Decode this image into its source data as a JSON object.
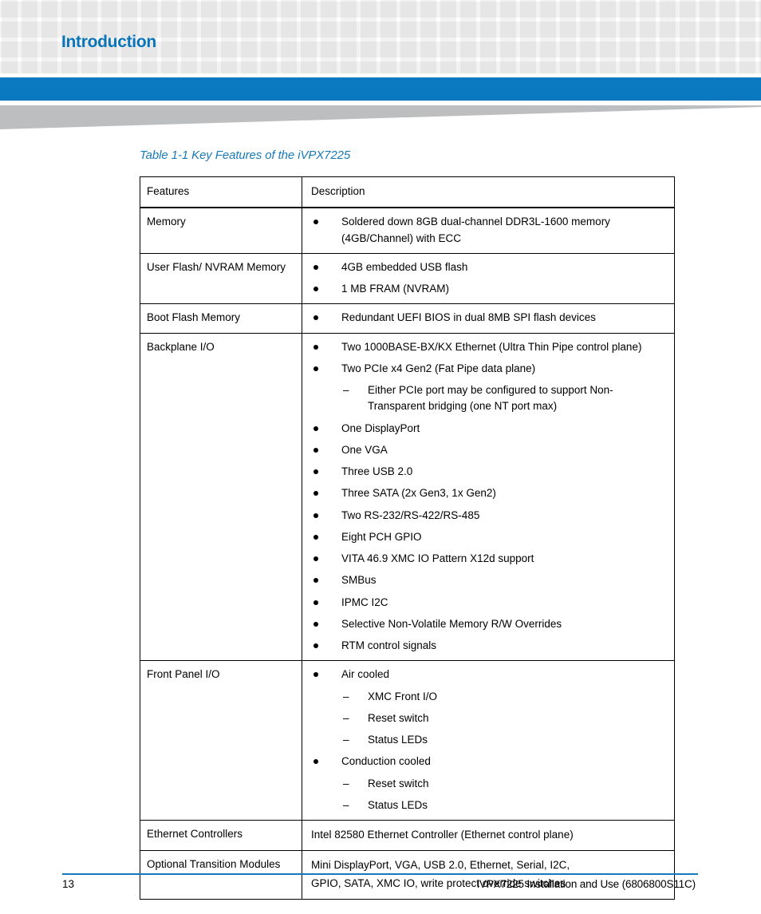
{
  "header": {
    "chapter_title": "Introduction"
  },
  "caption": {
    "text": "Table 1-1 Key Features of the iVPX7225"
  },
  "table": {
    "columns": [
      "Features",
      "Description"
    ],
    "rows": [
      {
        "feature": "Memory",
        "items": [
          {
            "level": 1,
            "text": "Soldered down 8GB dual-channel DDR3L-1600 memory (4GB/Channel) with ECC"
          }
        ]
      },
      {
        "feature": "User Flash/ NVRAM Memory",
        "items": [
          {
            "level": 1,
            "text": "4GB embedded USB flash"
          },
          {
            "level": 1,
            "text": "1 MB FRAM (NVRAM)"
          }
        ]
      },
      {
        "feature": "Boot Flash Memory",
        "items": [
          {
            "level": 1,
            "text": "Redundant UEFI BIOS in dual 8MB SPI flash devices"
          }
        ]
      },
      {
        "feature": "Backplane I/O",
        "items": [
          {
            "level": 1,
            "text": "Two 1000BASE-BX/KX Ethernet (Ultra Thin Pipe control plane)"
          },
          {
            "level": 1,
            "text": "Two PCIe x4 Gen2 (Fat Pipe data plane)"
          },
          {
            "level": 2,
            "text": "Either PCIe port may be configured to support Non-Transparent bridging (one NT port max)"
          },
          {
            "level": 1,
            "text": "One DisplayPort"
          },
          {
            "level": 1,
            "text": "One VGA"
          },
          {
            "level": 1,
            "text": "Three USB 2.0"
          },
          {
            "level": 1,
            "text": "Three SATA (2x Gen3, 1x Gen2)"
          },
          {
            "level": 1,
            "text": "Two RS-232/RS-422/RS-485"
          },
          {
            "level": 1,
            "text": "Eight PCH GPIO"
          },
          {
            "level": 1,
            "text": "VITA 46.9 XMC IO Pattern X12d support"
          },
          {
            "level": 1,
            "text": "SMBus"
          },
          {
            "level": 1,
            "text": "IPMC I2C"
          },
          {
            "level": 1,
            "text": "Selective Non-Volatile Memory R/W Overrides"
          },
          {
            "level": 1,
            "text": "RTM control signals"
          }
        ]
      },
      {
        "feature": "Front Panel I/O",
        "items": [
          {
            "level": 1,
            "text": "Air cooled"
          },
          {
            "level": 2,
            "text": "XMC Front I/O"
          },
          {
            "level": 2,
            "text": "Reset switch"
          },
          {
            "level": 2,
            "text": "Status LEDs"
          },
          {
            "level": 1,
            "text": "Conduction cooled"
          },
          {
            "level": 2,
            "text": "Reset switch"
          },
          {
            "level": 2,
            "text": "Status LEDs"
          }
        ]
      },
      {
        "feature": "Ethernet Controllers",
        "lines": [
          "Intel 82580 Ethernet Controller (Ethernet control plane)"
        ]
      },
      {
        "feature": "Optional Transition Modules",
        "lines": [
          "Mini DisplayPort, VGA, USB 2.0, Ethernet, Serial, I2C,",
          "GPIO, SATA, XMC IO, write protect override switches"
        ]
      }
    ]
  },
  "footer": {
    "page_number": "13",
    "document_title": "iVPX7225 Installation and Use (6806800S11C)"
  },
  "colors": {
    "accent_blue": "#0a79bf",
    "title_blue": "#0a74b9",
    "caption_blue": "#1a7ab8",
    "wedge_gray": "#bcbec0",
    "grid_gray": "#f2f2f2"
  }
}
